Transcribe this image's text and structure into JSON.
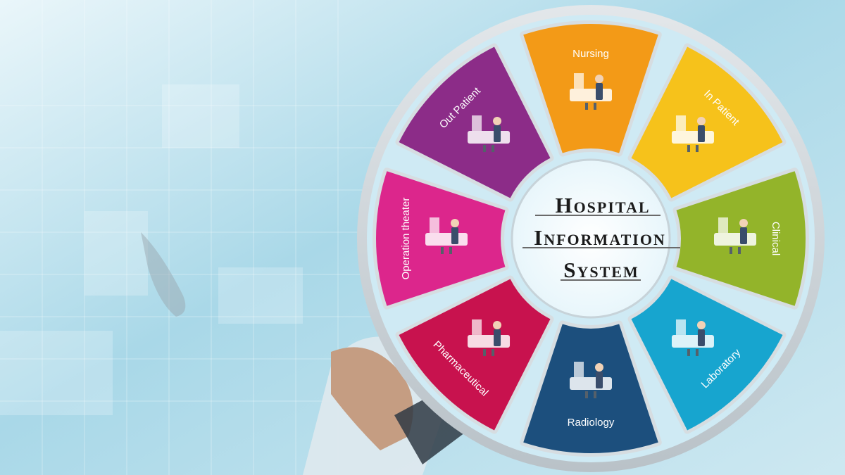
{
  "title": {
    "line1": "Hospital",
    "line2": "Information",
    "line3": "System"
  },
  "segments": [
    {
      "label": "Nursing",
      "color": "#f39a17"
    },
    {
      "label": "In Patient",
      "color": "#f6c21b"
    },
    {
      "label": "Clinical",
      "color": "#93b42a"
    },
    {
      "label": "Laboratory",
      "color": "#17a5cf"
    },
    {
      "label": "Radiology",
      "color": "#1c4f7d"
    },
    {
      "label": "Pharmaceutical",
      "color": "#c8124e"
    },
    {
      "label": "Operation theater",
      "color": "#dc268c"
    },
    {
      "label": "Out Patient",
      "color": "#8c2c88"
    }
  ]
}
